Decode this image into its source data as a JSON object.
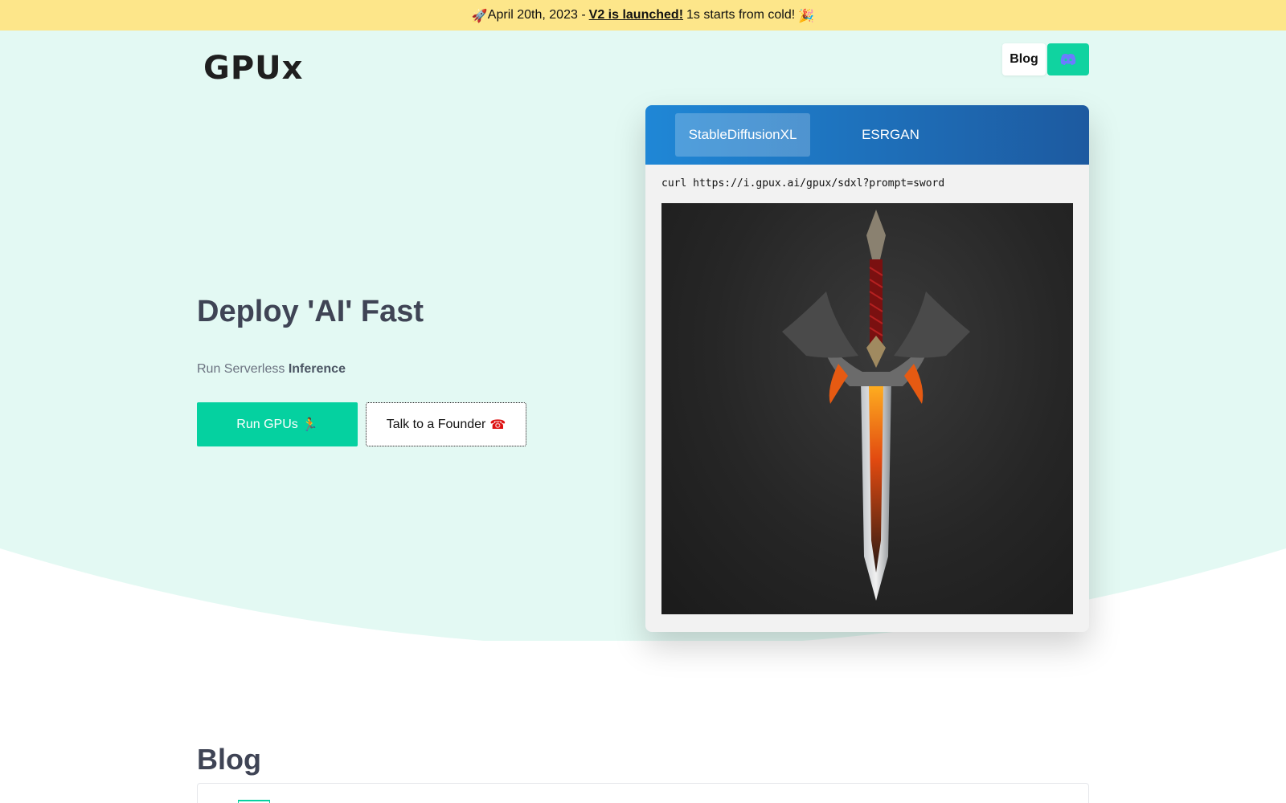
{
  "announcement": {
    "rocket_emoji": "🚀",
    "prefix": "April 20th, 2023 -",
    "link_text": "V2 is launched!",
    "suffix": "1s starts from cold!",
    "party_emoji": "🎉"
  },
  "colors": {
    "banner": "#fde68a",
    "hero_bg": "#e3f9f3",
    "accent": "#05d1a0",
    "tab_gradient_start": "#1f87d6",
    "tab_gradient_end": "#1d5aa0"
  },
  "header": {
    "logo_text": "GPUx",
    "nav_blog": "Blog",
    "discord_icon": "discord-icon"
  },
  "hero": {
    "title": "Deploy 'AI' Fast",
    "subtitle_prefix": "Run Serverless",
    "subtitle_bold": "Inference",
    "primary_button": "Run GPUs",
    "primary_emoji": "🏃",
    "secondary_button": "Talk to a Founder",
    "secondary_emoji": "☎"
  },
  "demo": {
    "tabs": [
      "StableDiffusionXL",
      "ESRGAN"
    ],
    "active_tab": "StableDiffusionXL",
    "command": "curl https://i.gpux.ai/gpux/sdxl?prompt=sword",
    "image_subject": "sword"
  },
  "blog": {
    "heading": "Blog"
  }
}
